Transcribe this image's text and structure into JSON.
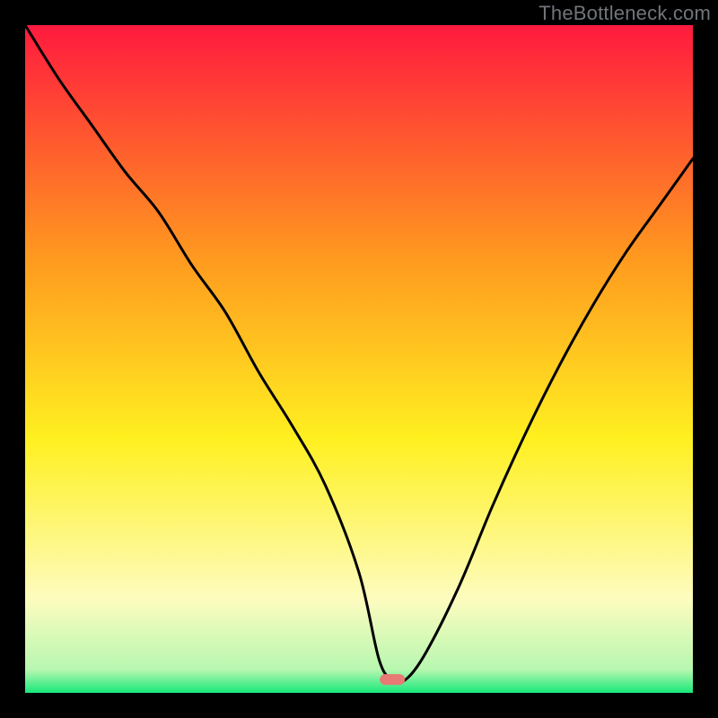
{
  "watermark": "TheBottleneck.com",
  "colors": {
    "red": "#ff1a3e",
    "orange": "#ff9a1f",
    "yellow": "#fff020",
    "paleyellow": "#fdfcbf",
    "green": "#17e87a",
    "black": "#000000",
    "curve": "#000000",
    "marker": "#e77a74"
  },
  "chart_data": {
    "type": "line",
    "title": "",
    "xlabel": "",
    "ylabel": "",
    "xlim": [
      0,
      100
    ],
    "ylim": [
      0,
      100
    ],
    "grid": false,
    "legend": false,
    "annotations": [
      {
        "kind": "marker",
        "x": 55,
        "y": 2,
        "shape": "rounded-rect"
      }
    ],
    "series": [
      {
        "name": "bottleneck-curve",
        "x": [
          0,
          5,
          10,
          15,
          20,
          25,
          30,
          35,
          40,
          45,
          50,
          53,
          55,
          57,
          60,
          65,
          70,
          75,
          80,
          85,
          90,
          95,
          100
        ],
        "values": [
          100,
          92,
          85,
          78,
          72,
          64,
          57,
          48,
          40,
          31,
          18,
          5,
          2,
          2,
          6,
          16,
          28,
          39,
          49,
          58,
          66,
          73,
          80
        ]
      }
    ],
    "background_gradient_stops": [
      {
        "pos": 0.0,
        "color": "#ff1a3e"
      },
      {
        "pos": 0.35,
        "color": "#ff9a1f"
      },
      {
        "pos": 0.62,
        "color": "#fff020"
      },
      {
        "pos": 0.86,
        "color": "#fdfcbf"
      },
      {
        "pos": 0.965,
        "color": "#b8f7b0"
      },
      {
        "pos": 1.0,
        "color": "#17e87a"
      }
    ]
  }
}
